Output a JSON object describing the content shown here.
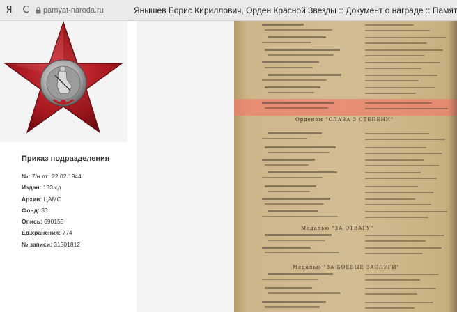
{
  "browser": {
    "logo": "Я",
    "reload_glyph": "C",
    "domain": "pamyat-naroda.ru",
    "title": "Янышев Борис Кириллович, Орден Красной Звезды :: Документ о награде :: Память народа"
  },
  "medal": {
    "icon": "order-of-red-star",
    "color": "#b0232a"
  },
  "document": {
    "title": "Приказ подразделения",
    "fields": [
      {
        "label": "№:",
        "value": "7/н",
        "label2": "от:",
        "value2": "22.02.1944"
      },
      {
        "label": "Издан:",
        "value": "133 сд"
      },
      {
        "label": "Архив:",
        "value": "ЦАМО"
      },
      {
        "label": "Фонд:",
        "value": "33"
      },
      {
        "label": "Опись:",
        "value": "690155"
      },
      {
        "label": "Ед.хранения:",
        "value": "774"
      },
      {
        "label": "№ записи:",
        "value": "31501812"
      }
    ]
  },
  "scan": {
    "highlight_color": "#ee7e6c",
    "section1": "Орденом \"СЛАВА 3 СТЕПЕНИ\"",
    "section2": "Медалью \"ЗА ОТВАГУ\"",
    "section3": "Медалью \"ЗА БОЕВЫЕ ЗАСЛУГИ\""
  }
}
